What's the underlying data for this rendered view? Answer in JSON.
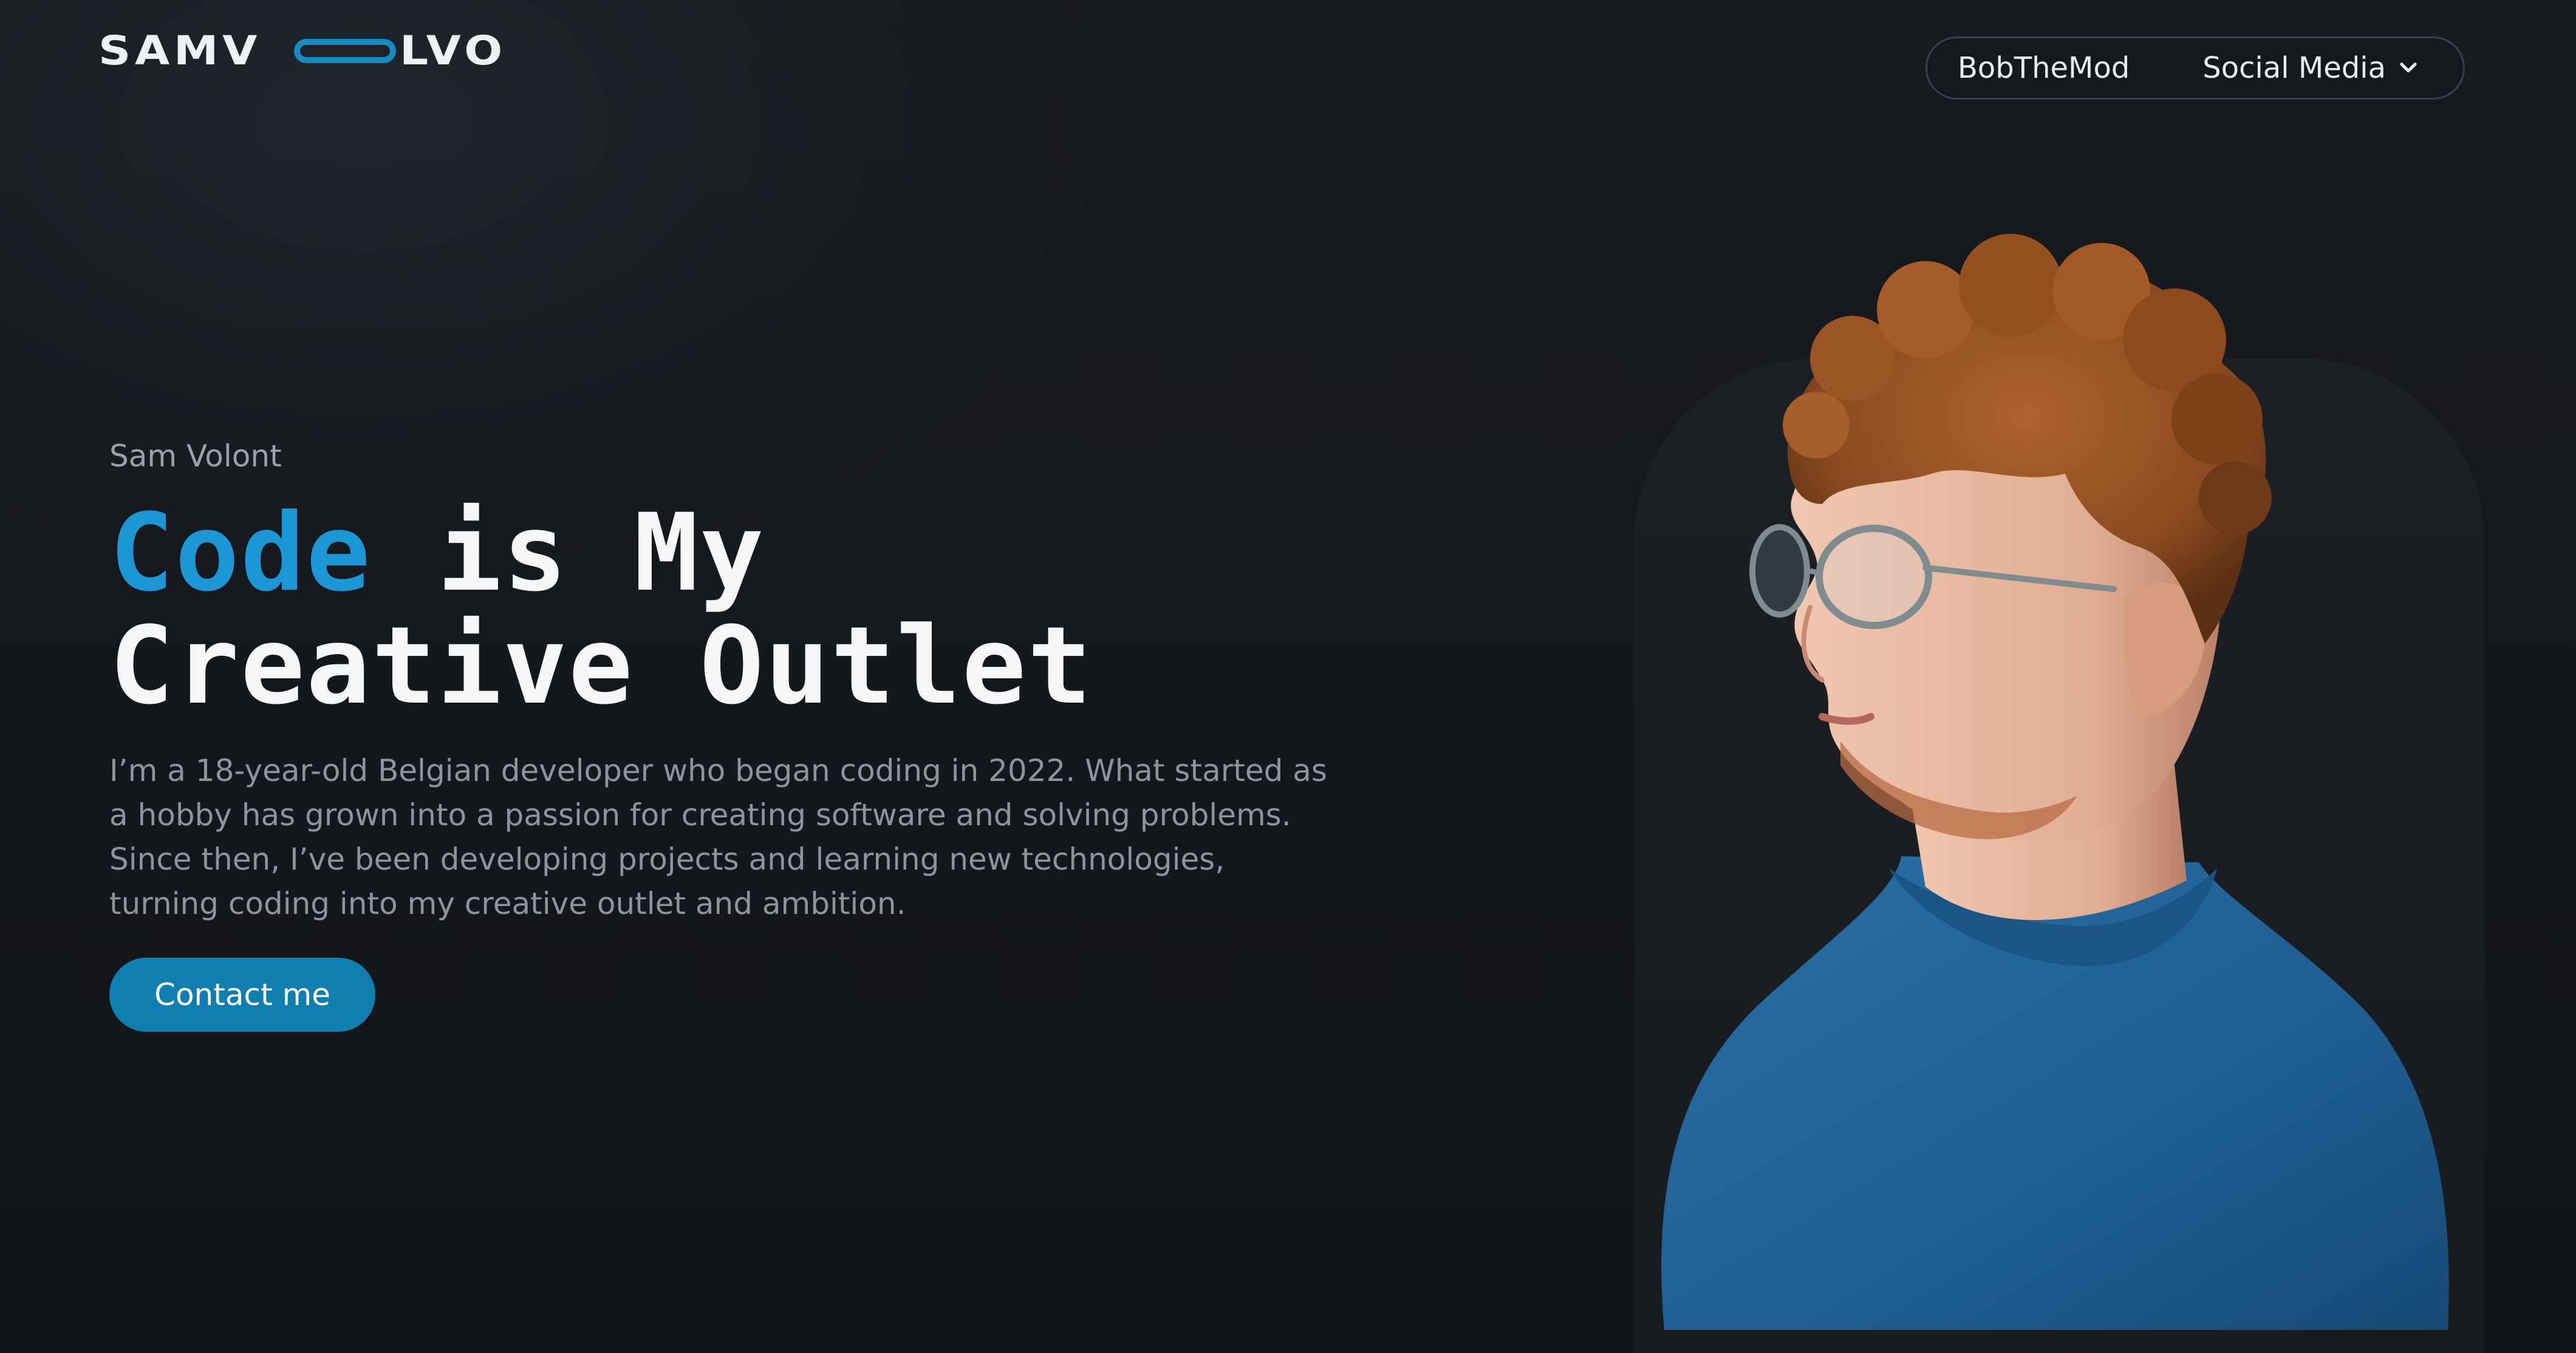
{
  "header": {
    "logo": {
      "left_text": "SAMV",
      "right_text": "LVO",
      "accent_color": "#168ac1"
    },
    "nav": {
      "item_1": "BobTheMod",
      "item_2": "Social Media",
      "item_2_icon": "chevron-down-icon"
    }
  },
  "hero": {
    "subtitle": "Sam Volont",
    "headline": {
      "accent": "Code",
      "line1_rest": " is My",
      "line2": "Creative Outlet"
    },
    "description": "I’m a 18-year-old Belgian developer who began coding in 2022. What started as a hobby has grown into a passion for creating software and solving problems. Since then, I’ve been developing projects and learning new technologies, turning coding into my creative outlet and ambition.",
    "cta_label": "Contact me"
  },
  "colors": {
    "background": "#15181c",
    "accent": "#1b97d6",
    "button": "#0e7fae"
  }
}
